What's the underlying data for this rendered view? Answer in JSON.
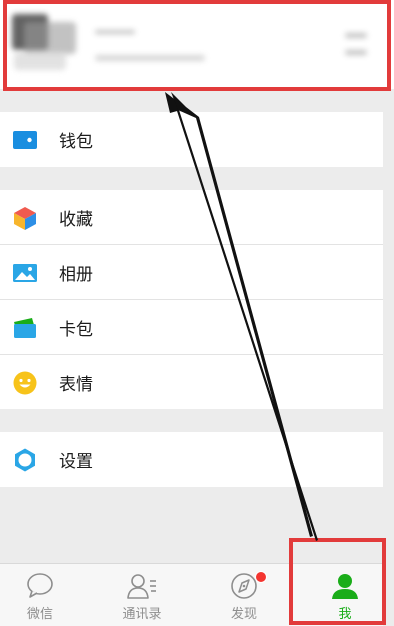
{
  "menu": {
    "wallet": {
      "label": "钱包",
      "icon": "wallet-icon"
    },
    "items": [
      {
        "label": "收藏",
        "icon": "favorites-cube-icon"
      },
      {
        "label": "相册",
        "icon": "album-image-icon"
      },
      {
        "label": "卡包",
        "icon": "card-pack-icon"
      },
      {
        "label": "表情",
        "icon": "sticker-smile-icon"
      }
    ],
    "settings": {
      "label": "设置",
      "icon": "settings-gear-icon"
    }
  },
  "tabs": [
    {
      "label": "微信",
      "icon": "chat-bubble-icon",
      "active": false
    },
    {
      "label": "通讯录",
      "icon": "contacts-icon",
      "active": false
    },
    {
      "label": "发现",
      "icon": "compass-icon",
      "active": false,
      "badge": true
    },
    {
      "label": "我",
      "icon": "me-person-icon",
      "active": true
    }
  ],
  "colors": {
    "accent": "#1aad19",
    "annotation": "#e23b3b",
    "wallet_icon": "#1a8ee0",
    "badge": "#f43530"
  }
}
